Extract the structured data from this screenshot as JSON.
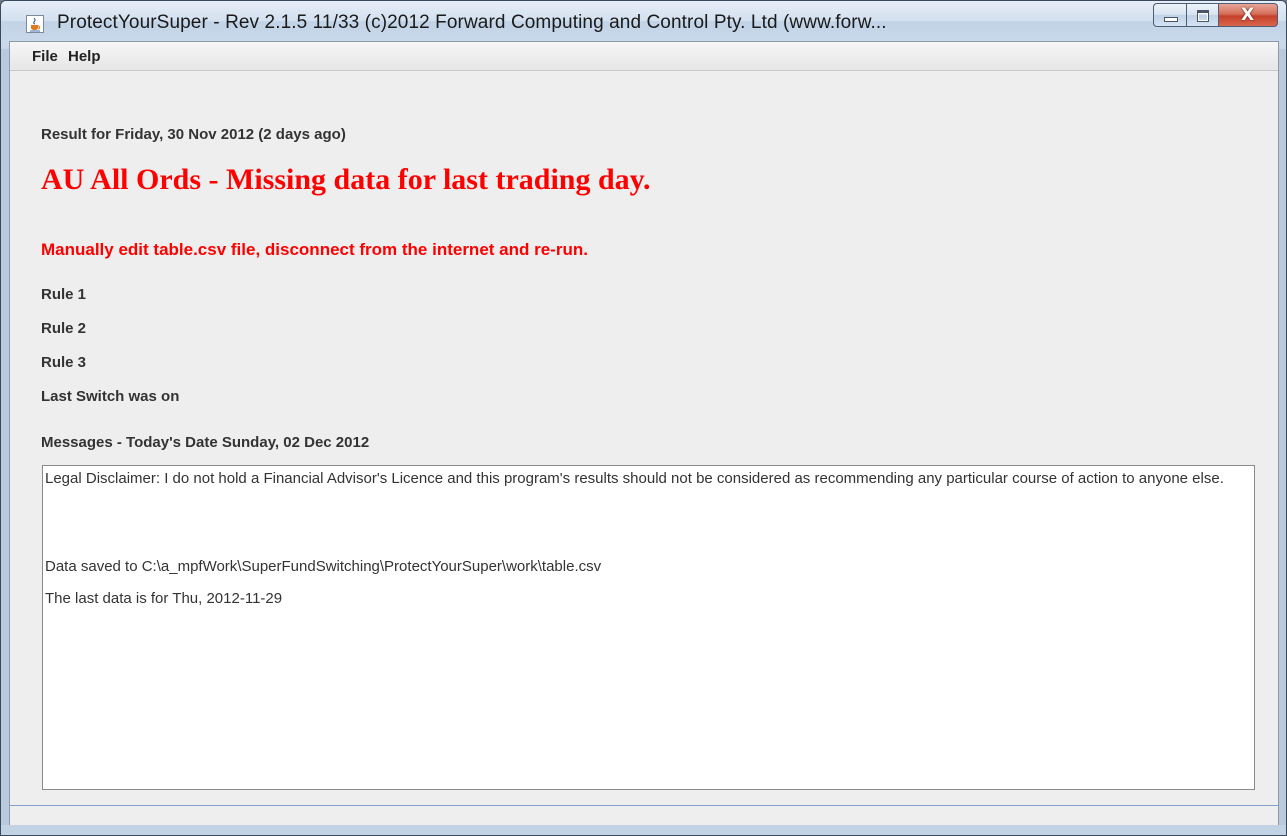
{
  "window": {
    "title": "ProtectYourSuper - Rev 2.1.5  11/33 (c)2012 Forward Computing and Control Pty. Ltd (www.forw...",
    "app_icon": "java-cup-icon",
    "close_label": "X"
  },
  "menu": {
    "items": [
      "File",
      "Help"
    ]
  },
  "result": {
    "date_label": "Result for Friday, 30 Nov 2012 (2 days ago)",
    "headline": "AU All Ords - Missing data for last trading day.",
    "instruction": "Manually edit table.csv file, disconnect from the internet and re-run.",
    "rule1": "Rule 1",
    "rule2": "Rule 2",
    "rule3": "Rule 3",
    "last_switch": "Last Switch was on"
  },
  "messages": {
    "header": "Messages - Today's Date Sunday, 02 Dec 2012",
    "disclaimer": "Legal Disclaimer: I do not hold a Financial Advisor's Licence and this program's results should not be considered as recommending any particular course of action to anyone else.",
    "saved": "Data saved to C:\\a_mpfWork\\SuperFundSwitching\\ProtectYourSuper\\work\\table.csv",
    "last_data": "The last data is for Thu, 2012-11-29"
  },
  "colors": {
    "alert": "#ff0000",
    "text": "#333333",
    "panel": "#eeeeee"
  }
}
